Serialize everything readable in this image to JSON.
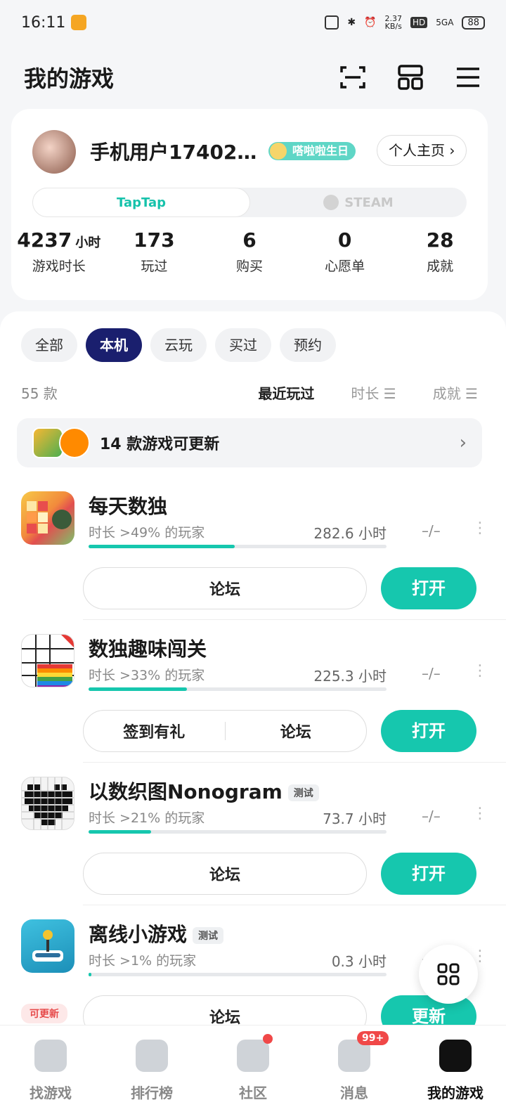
{
  "status_bar": {
    "time": "16:11",
    "net_rate": "2.37",
    "net_unit": "KB/s",
    "hd": "HD",
    "signal": "5GA",
    "battery": "88"
  },
  "header": {
    "title": "我的游戏"
  },
  "profile": {
    "username": "手机用户17402…",
    "birthday_badge": "嗒啦啦生日",
    "home_button": "个人主页",
    "platform_tabs": [
      "TapTap",
      "STEAM"
    ],
    "stats": [
      {
        "value": "4237",
        "unit": "小时",
        "label": "游戏时长"
      },
      {
        "value": "173",
        "unit": "",
        "label": "玩过"
      },
      {
        "value": "6",
        "unit": "",
        "label": "购买"
      },
      {
        "value": "0",
        "unit": "",
        "label": "心愿单"
      },
      {
        "value": "28",
        "unit": "",
        "label": "成就"
      }
    ]
  },
  "filters": [
    "全部",
    "本机",
    "云玩",
    "买过",
    "预约"
  ],
  "list_header": {
    "count": "55 款",
    "sort_recent": "最近玩过",
    "sort_duration": "时长 ☰",
    "sort_achievement": "成就 ☰"
  },
  "update_banner": {
    "text": "14 款游戏可更新"
  },
  "games": [
    {
      "name": "每天数独",
      "tag": "",
      "percent_text": "时长 >49% 的玩家",
      "progress": 0.49,
      "hours": "282.6 小时",
      "achievement": "–/–",
      "actions": [
        "论坛"
      ],
      "primary": "打开",
      "update_badge": ""
    },
    {
      "name": "数独趣味闯关",
      "tag": "",
      "percent_text": "时长 >33% 的玩家",
      "progress": 0.33,
      "hours": "225.3 小时",
      "achievement": "–/–",
      "actions": [
        "签到有礼",
        "论坛"
      ],
      "primary": "打开",
      "update_badge": ""
    },
    {
      "name": "以数织图Nonogram",
      "tag": "测试",
      "percent_text": "时长 >21% 的玩家",
      "progress": 0.21,
      "hours": "73.7 小时",
      "achievement": "–/–",
      "actions": [
        "论坛"
      ],
      "primary": "打开",
      "update_badge": ""
    },
    {
      "name": "离线小游戏",
      "tag": "测试",
      "percent_text": "时长 >1% 的玩家",
      "progress": 0.01,
      "hours": "0.3 小时",
      "achievement": "–/–",
      "actions": [
        "论坛"
      ],
      "primary": "更新",
      "update_badge": "可更新"
    }
  ],
  "bottom_nav": [
    {
      "label": "找游戏"
    },
    {
      "label": "排行榜"
    },
    {
      "label": "社区"
    },
    {
      "label": "消息",
      "badge": "99+"
    },
    {
      "label": "我的游戏"
    }
  ],
  "colors": {
    "accent": "#16c7ae",
    "active_chip": "#1a1f6e",
    "badge_red": "#f04848"
  }
}
